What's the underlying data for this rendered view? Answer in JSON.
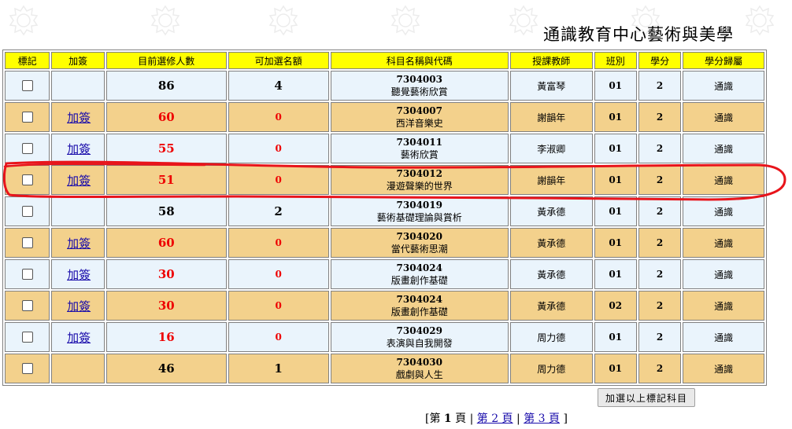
{
  "title": "通識教育中心藝術與美學",
  "table": {
    "headers": [
      "標記",
      "加簽",
      "目前選修人數",
      "可加選名額",
      "科目名稱與代碼",
      "授課教師",
      "班別",
      "學分",
      "學分歸屬"
    ],
    "rows": [
      {
        "add": "",
        "enrolled": "86",
        "available": "4",
        "code": "7304003",
        "name": "聽覺藝術欣賞",
        "teacher": "黃富琴",
        "class": "01",
        "credits": "2",
        "category": "通識"
      },
      {
        "add": "加簽",
        "enrolled": "60",
        "available": "0",
        "code": "7304007",
        "name": "西洋音樂史",
        "teacher": "謝韻年",
        "class": "01",
        "credits": "2",
        "category": "通識"
      },
      {
        "add": "加簽",
        "enrolled": "55",
        "available": "0",
        "code": "7304011",
        "name": "藝術欣賞",
        "teacher": "李淑卿",
        "class": "01",
        "credits": "2",
        "category": "通識"
      },
      {
        "add": "加簽",
        "enrolled": "51",
        "available": "0",
        "code": "7304012",
        "name": "漫遊聲樂的世界",
        "teacher": "謝韻年",
        "class": "01",
        "credits": "2",
        "category": "通識"
      },
      {
        "add": "",
        "enrolled": "58",
        "available": "2",
        "code": "7304019",
        "name": "藝術基礎理論與賞析",
        "teacher": "黃承德",
        "class": "01",
        "credits": "2",
        "category": "通識"
      },
      {
        "add": "加簽",
        "enrolled": "60",
        "available": "0",
        "code": "7304020",
        "name": "當代藝術思潮",
        "teacher": "黃承德",
        "class": "01",
        "credits": "2",
        "category": "通識"
      },
      {
        "add": "加簽",
        "enrolled": "30",
        "available": "0",
        "code": "7304024",
        "name": "版畫創作基礎",
        "teacher": "黃承德",
        "class": "01",
        "credits": "2",
        "category": "通識"
      },
      {
        "add": "加簽",
        "enrolled": "30",
        "available": "0",
        "code": "7304024",
        "name": "版畫創作基礎",
        "teacher": "黃承德",
        "class": "02",
        "credits": "2",
        "category": "通識"
      },
      {
        "add": "加簽",
        "enrolled": "16",
        "available": "0",
        "code": "7304029",
        "name": "表演與自我開發",
        "teacher": "周力德",
        "class": "01",
        "credits": "2",
        "category": "通識"
      },
      {
        "add": "",
        "enrolled": "46",
        "available": "1",
        "code": "7304030",
        "name": "戲劇與人生",
        "teacher": "周力德",
        "class": "01",
        "credits": "2",
        "category": "通識"
      }
    ]
  },
  "submit_label": "加選以上標記科目",
  "pager": {
    "open": "[",
    "current_prefix": "第",
    "current": "1",
    "current_suffix": "頁",
    "sep": "|",
    "page2": "第 2 頁",
    "page3": "第 3 頁",
    "close": "]"
  },
  "colors": {
    "header": "#ffff00",
    "row_light": "#eaf4fc",
    "row_orange": "#f3d18c",
    "full_red": "#ee0000",
    "link": "#1a0dab",
    "annotation": "#e8141b"
  },
  "annotation": {
    "shape": "hand-drawn-ellipse",
    "highlighted_row": 4
  }
}
